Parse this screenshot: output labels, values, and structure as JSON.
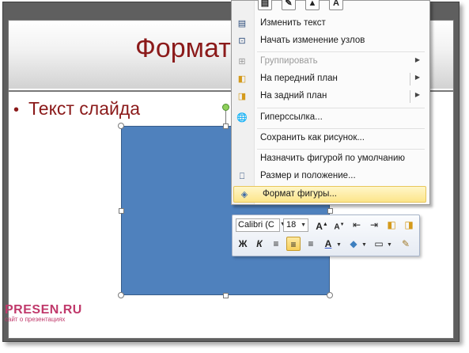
{
  "slide": {
    "title": "Формат",
    "bullet": "Текст слайда"
  },
  "watermark": {
    "main": "PRESEN.RU",
    "sub": "сайт о презентациях"
  },
  "context_menu": {
    "top_icons": [
      {
        "icon": "text-box-icon"
      },
      {
        "icon": "shape-style-icon"
      },
      {
        "icon": "picture-fill-icon"
      },
      {
        "icon": "text-style-icon",
        "glyph": "A"
      }
    ],
    "items": [
      {
        "label": "Изменить текст",
        "icon": "edit-text-icon",
        "disabled": false,
        "submenu": false
      },
      {
        "label": "Начать изменение узлов",
        "icon": "edit-points-icon",
        "disabled": false,
        "submenu": false
      },
      {
        "label": "Группировать",
        "icon": "group-icon",
        "disabled": true,
        "submenu": true
      },
      {
        "label": "На передний план",
        "icon": "bring-to-front-icon",
        "disabled": false,
        "submenu": true
      },
      {
        "label": "На задний план",
        "icon": "send-to-back-icon",
        "disabled": false,
        "submenu": true
      },
      {
        "label": "Гиперссылка...",
        "icon": "hyperlink-icon",
        "disabled": false,
        "submenu": false
      },
      {
        "label": "Сохранить как рисунок...",
        "icon": "",
        "disabled": false,
        "submenu": false
      },
      {
        "label": "Назначить фигурой по умолчанию",
        "icon": "",
        "disabled": false,
        "submenu": false
      },
      {
        "label": "Размер и положение...",
        "icon": "size-position-icon",
        "disabled": false,
        "submenu": false
      },
      {
        "label": "Формат фигуры...",
        "icon": "format-shape-icon",
        "disabled": false,
        "submenu": false,
        "highlighted": true
      }
    ]
  },
  "mini_toolbar": {
    "font": "Calibri (C",
    "size": "18",
    "row1": [
      "A",
      "A",
      "≡",
      "≡",
      "▣",
      "▣"
    ],
    "row2": [
      "Ж",
      "К",
      "≡",
      "≡",
      "≡",
      "A",
      "◆",
      "▭",
      "✎"
    ]
  },
  "colors": {
    "shape_fill": "#4f81bd",
    "title_color": "#8b1a1a",
    "highlight": "#fce58a",
    "watermark": "#c0396b"
  }
}
